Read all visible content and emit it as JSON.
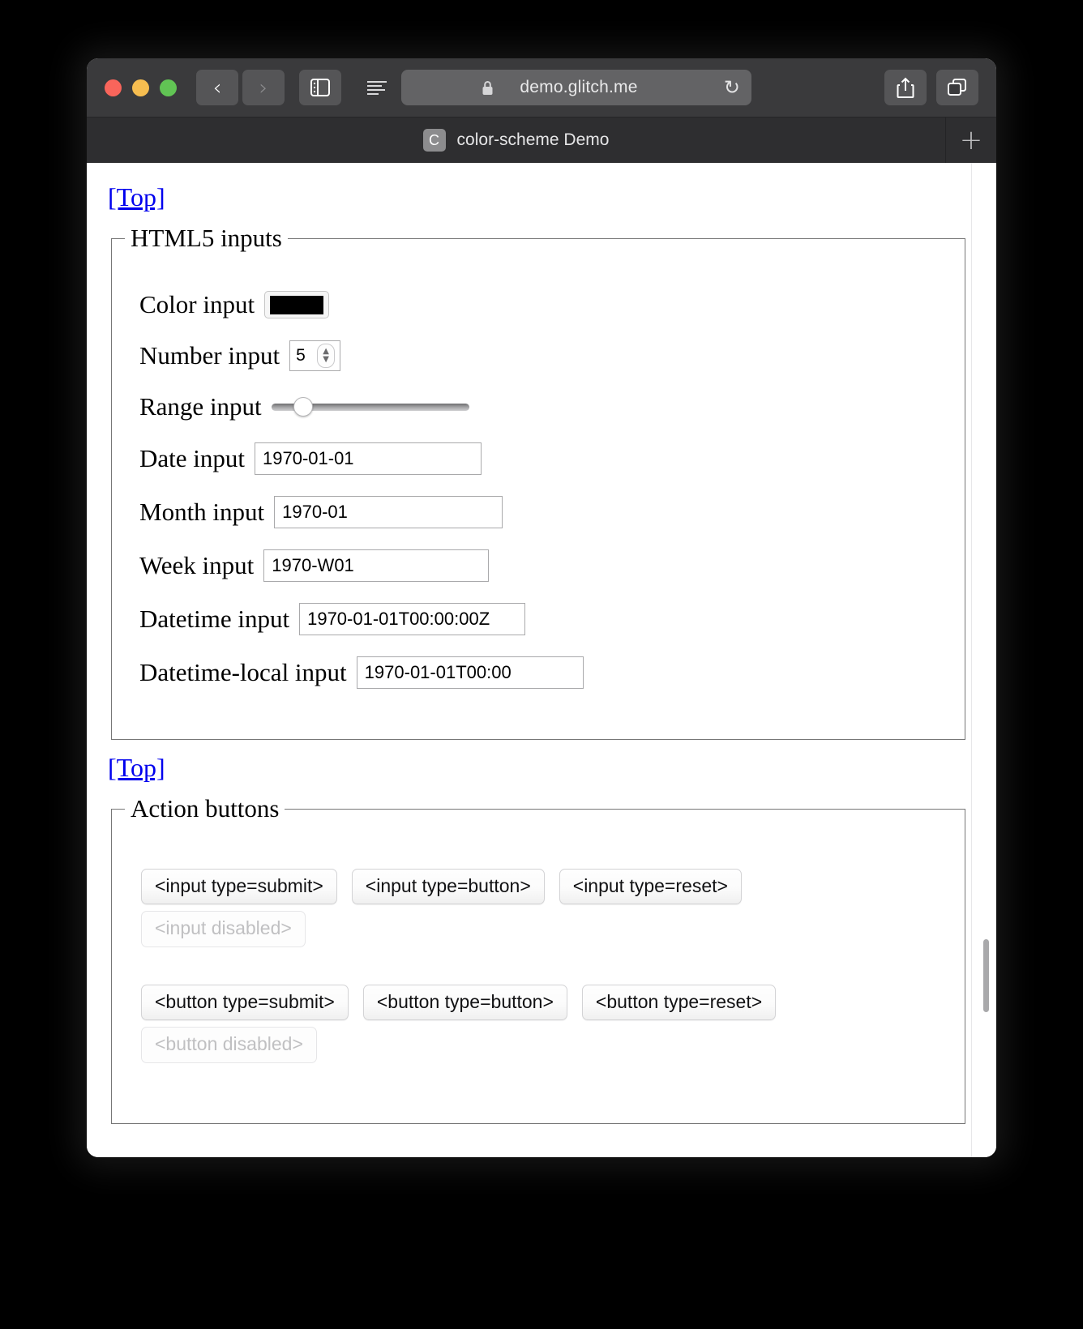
{
  "window": {
    "traffic_lights": [
      "close",
      "minimize",
      "zoom"
    ],
    "colors": {
      "toolbar_bg": "#3a3a3c",
      "tabbar_bg": "#2e2e30",
      "link": "#0000ee",
      "color_input_value": "#000000"
    }
  },
  "toolbar": {
    "back_glyph": "‹",
    "forward_glyph": "›",
    "sidebar_label": "sidebar",
    "reader_label": "reader",
    "url": "demo.glitch.me",
    "reload_glyph": "↻",
    "share_label": "share",
    "tabs_label": "tab overview"
  },
  "tabbar": {
    "favicon_letter": "C",
    "title": "color-scheme Demo",
    "newtab_glyph": "+"
  },
  "page": {
    "top_link_1": "[Top]",
    "top_link_2": "[Top]",
    "fieldset_inputs": {
      "legend": "HTML5 inputs",
      "rows": [
        {
          "label": "Color input",
          "kind": "color",
          "value": "#000000"
        },
        {
          "label": "Number input",
          "kind": "number",
          "value": "5"
        },
        {
          "label": "Range input",
          "kind": "range",
          "value": "11"
        },
        {
          "label": "Date input",
          "kind": "text",
          "value": "1970-01-01"
        },
        {
          "label": "Month input",
          "kind": "text",
          "value": "1970-01"
        },
        {
          "label": "Week input",
          "kind": "text",
          "value": "1970-W01"
        },
        {
          "label": "Datetime input",
          "kind": "text",
          "value": "1970-01-01T00:00:00Z"
        },
        {
          "label": "Datetime-local input",
          "kind": "text",
          "value": "1970-01-01T00:00"
        }
      ]
    },
    "fieldset_buttons": {
      "legend": "Action buttons",
      "input_row": [
        {
          "label": "<input type=submit>",
          "disabled": false
        },
        {
          "label": "<input type=button>",
          "disabled": false
        },
        {
          "label": "<input type=reset>",
          "disabled": false
        }
      ],
      "input_disabled": {
        "label": "<input disabled>",
        "disabled": true
      },
      "button_row": [
        {
          "label": "<button type=submit>",
          "disabled": false
        },
        {
          "label": "<button type=button>",
          "disabled": false
        },
        {
          "label": "<button type=reset>",
          "disabled": false
        }
      ],
      "button_disabled": {
        "label": "<button disabled>",
        "disabled": true
      }
    }
  }
}
